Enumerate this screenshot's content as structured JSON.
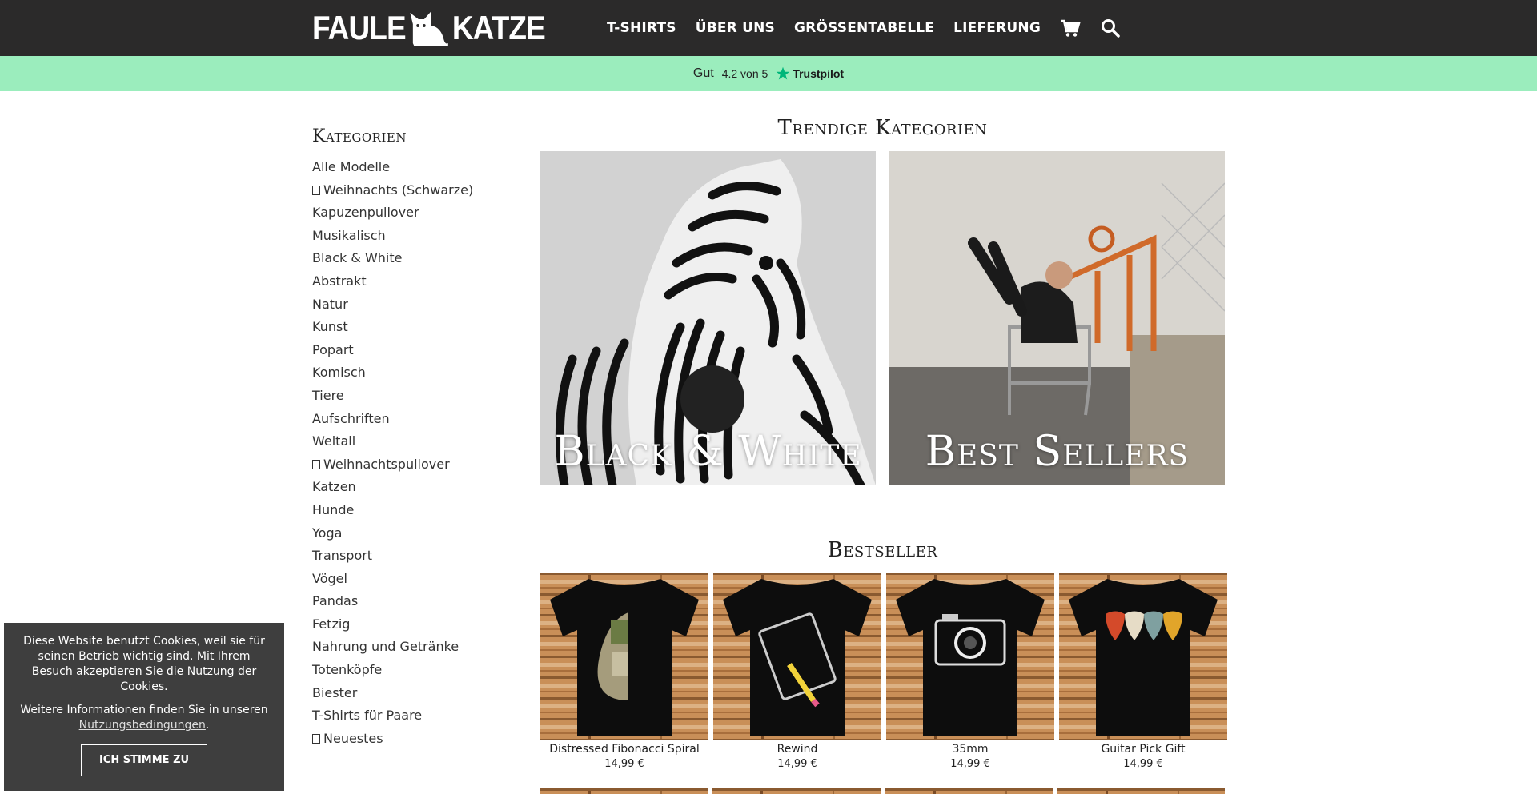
{
  "brand": {
    "left": "FAULE",
    "right": "KATZE"
  },
  "nav": {
    "items": [
      "T-SHIRTS",
      "ÜBER UNS",
      "GRÖSSENTABELLE",
      "LIEFERUNG"
    ],
    "cart_icon": "cart-icon",
    "search_icon": "search-icon"
  },
  "trustbar": {
    "word": "Gut",
    "rating": "4.2 von 5",
    "brand": "Trustpilot",
    "star_color": "#00b67a",
    "bg": "#9bedbd"
  },
  "sidebar": {
    "title": "Kategorien",
    "items": [
      "Alle Modelle",
      "Weihnachts (Schwarze)",
      "Kapuzenpullover",
      "Musikalisch",
      "Black & White",
      "Abstrakt",
      "Natur",
      "Kunst",
      "Popart",
      "Komisch",
      "Tiere",
      "Aufschriften",
      "Weltall",
      "Weihnachtspullover",
      "Katzen",
      "Hunde",
      "Yoga",
      "Transport",
      "Vögel",
      "Pandas",
      "Fetzig",
      "Nahrung und Getränke",
      "Totenköpfe",
      "Biester",
      "T-Shirts für Paare",
      "Neuestes"
    ]
  },
  "trending": {
    "title": "Trendige Kategorien",
    "tiles": [
      {
        "label": "Black & White"
      },
      {
        "label": "Best Sellers"
      }
    ]
  },
  "bestseller": {
    "title": "Bestseller",
    "products": [
      {
        "name": "Distressed Fibonacci Spiral",
        "price": "14,99 €"
      },
      {
        "name": "Rewind",
        "price": "14,99 €"
      },
      {
        "name": "35mm",
        "price": "14,99 €"
      },
      {
        "name": "Guitar Pick Gift",
        "price": "14,99 €"
      }
    ]
  },
  "cookie": {
    "text1": "Diese Website benutzt Cookies, weil sie für seinen Betrieb wichtig sind. Mit Ihrem Besuch akzeptieren Sie die Nutzung der Cookies.",
    "text2_prefix": "Weitere Informationen finden Sie in unseren",
    "link": "Nutzungsbedingungen",
    "text2_suffix": ".",
    "accept": "ICH STIMME ZU"
  }
}
